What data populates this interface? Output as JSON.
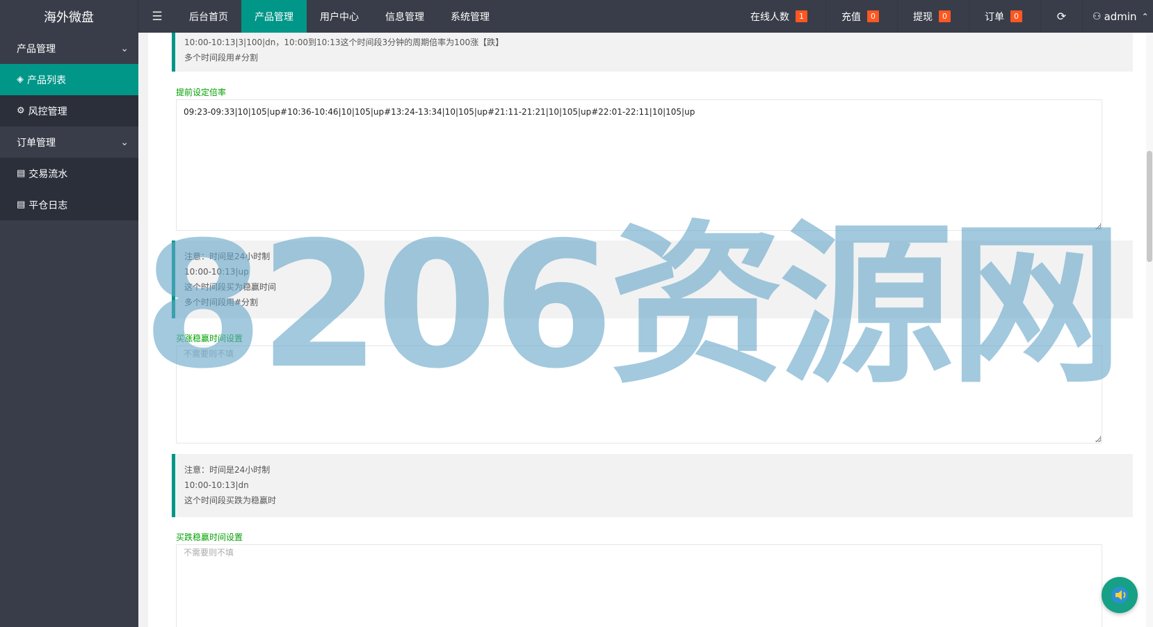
{
  "app": {
    "title": "海外微盘"
  },
  "nav": {
    "toggle_icon": "menu-indent-icon",
    "items": [
      {
        "label": "后台首页"
      },
      {
        "label": "产品管理",
        "active": true
      },
      {
        "label": "用户中心"
      },
      {
        "label": "信息管理"
      },
      {
        "label": "系统管理"
      }
    ],
    "stats": [
      {
        "label": "在线人数",
        "count": "1"
      },
      {
        "label": "充值",
        "count": "0"
      },
      {
        "label": "提现",
        "count": "0"
      },
      {
        "label": "订单",
        "count": "0"
      }
    ],
    "refresh_icon": "refresh-icon",
    "user": {
      "name": "admin"
    }
  },
  "sidebar": {
    "groups": [
      {
        "label": "产品管理",
        "items": [
          {
            "label": "产品列表",
            "active": true
          },
          {
            "label": "风控管理"
          }
        ]
      },
      {
        "label": "订单管理",
        "items": [
          {
            "label": "交易流水"
          },
          {
            "label": "平仓日志"
          }
        ]
      }
    ]
  },
  "form": {
    "quote1": {
      "line1": "10:00-10:13|3|100|dn，10:00到10:13这个时间段3分钟的周期倍率为100涨【跌】",
      "line2": "多个时间段用#分割"
    },
    "advance_rate": {
      "label": "提前设定倍率",
      "value": "09:23-09:33|10|105|up#10:36-10:46|10|105|up#13:24-13:34|10|105|up#21:11-21:21|10|105|up#22:01-22:11|10|105|up"
    },
    "quote2": {
      "line1": "注意：时间是24小时制",
      "line2": "10:00-10:13|up",
      "line3": "这个时间段买为稳赢时间",
      "line4": "多个时间段用#分割"
    },
    "buy_up_win": {
      "label": "买涨稳赢时间设置",
      "placeholder": "不需要则不填"
    },
    "quote3": {
      "line1": "注意：时间是24小时制",
      "line2": "10:00-10:13|dn",
      "line3": "这个时间段买跌为稳赢时"
    },
    "buy_down_win": {
      "label": "买跌稳赢时间设置",
      "placeholder": "不需要则不填"
    }
  },
  "watermark": {
    "text": "8206资源网"
  },
  "colors": {
    "header_bg": "#393d49",
    "accent": "#009688",
    "badge": "#ff5722",
    "label_green": "#00a000"
  }
}
